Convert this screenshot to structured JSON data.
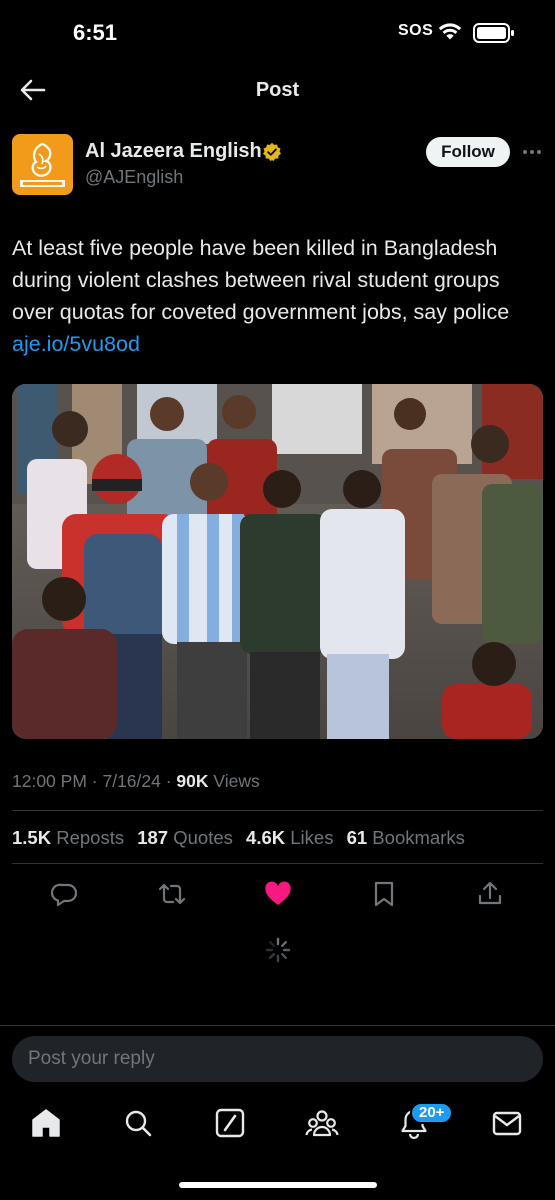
{
  "status": {
    "time": "6:51",
    "sos": "SOS"
  },
  "nav": {
    "title": "Post"
  },
  "author": {
    "name": "Al Jazeera English",
    "handle": "@AJEnglish",
    "follow_label": "Follow",
    "avatar_color": "#f29b1a"
  },
  "post": {
    "text": "At least five people have been killed in Bangladesh during violent clashes between rival student groups over quotas for coveted government jobs, say police ",
    "link": "aje.io/5vu8od"
  },
  "meta": {
    "time": "12:00 PM",
    "sep1": " · ",
    "date": "7/16/24",
    "sep2": " · ",
    "views_count": "90K",
    "views_label": " Views"
  },
  "stats": {
    "reposts_count": "1.5K",
    "reposts_label": " Reposts",
    "quotes_count": "187",
    "quotes_label": " Quotes",
    "likes_count": "4.6K",
    "likes_label": " Likes",
    "bookmarks_count": "61",
    "bookmarks_label": " Bookmarks"
  },
  "actions": [
    "reply-icon",
    "repost-icon",
    "like-icon",
    "bookmark-icon",
    "share-icon"
  ],
  "colors": {
    "accent": "#1d9bf0",
    "like": "#f91880",
    "muted": "#71767b"
  },
  "reply": {
    "placeholder": "Post your reply"
  },
  "tabs": [
    "home-icon",
    "search-icon",
    "grok-icon",
    "communities-icon",
    "notifications-icon",
    "messages-icon"
  ],
  "notifications_badge": "20+"
}
